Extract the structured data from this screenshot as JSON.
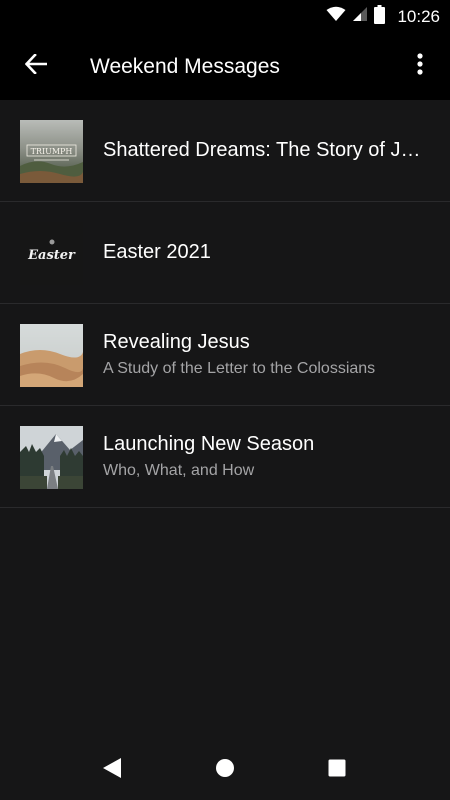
{
  "status_bar": {
    "time": "10:26",
    "icons": [
      "wifi-icon",
      "cell-signal-icon",
      "battery-icon"
    ]
  },
  "app_bar": {
    "back_icon": "arrow-left-icon",
    "title": "Weekend Messages",
    "overflow_icon": "more-vert-icon"
  },
  "series": [
    {
      "title": "Shattered Dreams: The Story of Joseph",
      "subtitle": "",
      "thumbnail": "shattered-dreams-thumbnail",
      "thumbnail_text": "TRIUMPH"
    },
    {
      "title": "Easter 2021",
      "subtitle": "",
      "thumbnail": "easter-thumbnail",
      "thumbnail_text": "Easter"
    },
    {
      "title": "Revealing Jesus",
      "subtitle": "A Study of the Letter to the Colossians",
      "thumbnail": "desert-dunes-thumbnail"
    },
    {
      "title": "Launching New Season",
      "subtitle": "Who, What, and How",
      "thumbnail": "mountain-road-thumbnail"
    }
  ],
  "nav_bar": {
    "back_icon": "nav-back-icon",
    "home_icon": "nav-home-icon",
    "recents_icon": "nav-recents-icon"
  },
  "colors": {
    "background": "#161617",
    "bar": "#000000",
    "title_text": "#ffffff",
    "subtitle_text": "#a4a4a6",
    "divider": "#2a2a2c"
  }
}
